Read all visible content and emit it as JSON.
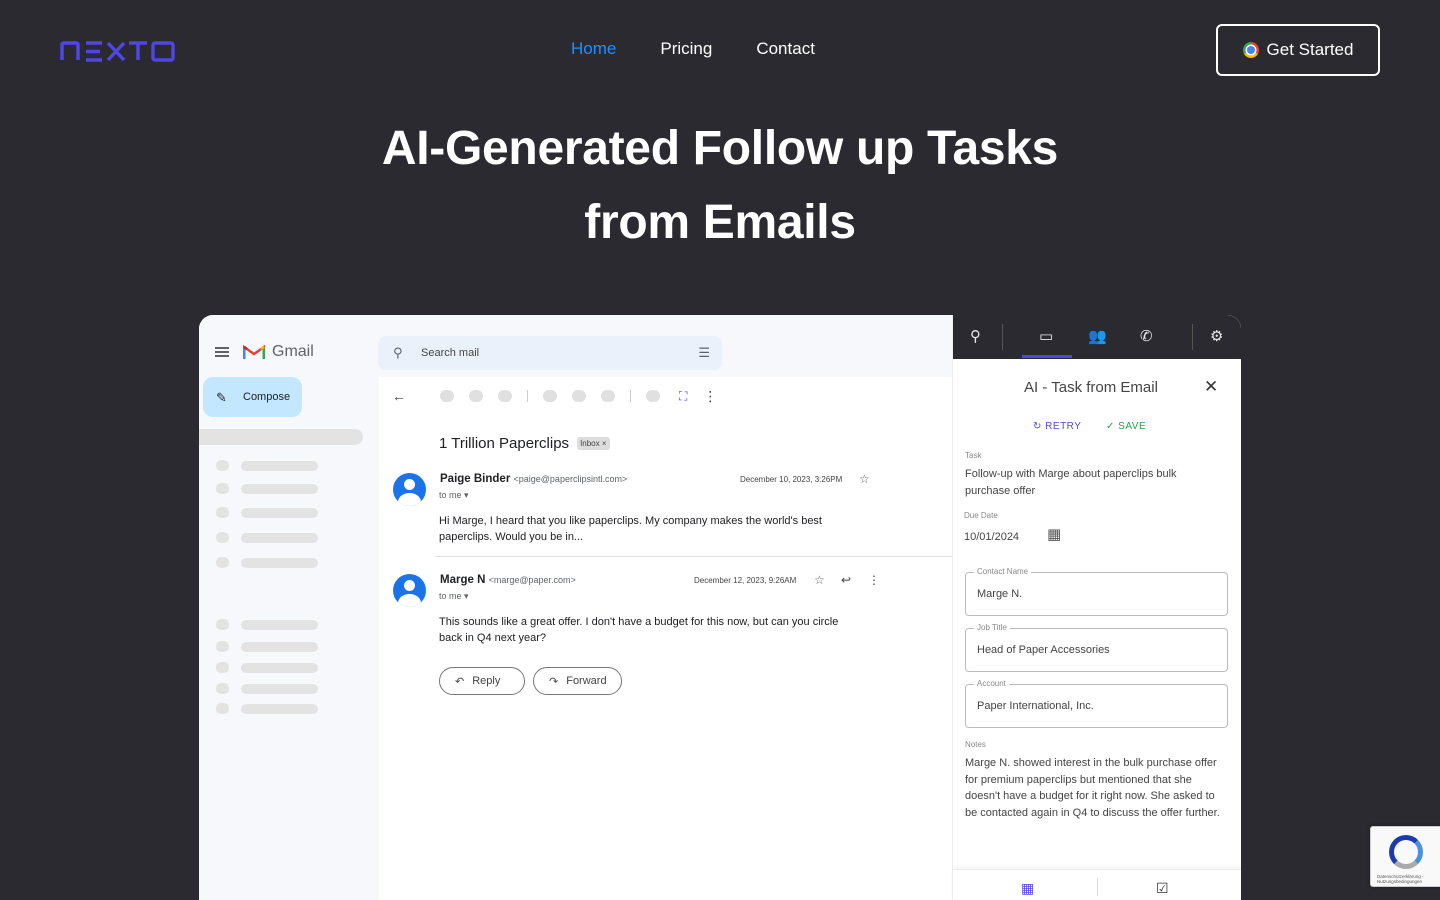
{
  "nav": {
    "logo": "nEXTO",
    "links": [
      "Home",
      "Pricing",
      "Contact"
    ],
    "cta_label": "Get Started"
  },
  "hero": {
    "line1": "AI-Generated Follow up Tasks",
    "line2": "from Emails"
  },
  "colors": {
    "accent": "#4f46e5",
    "active_link": "#1e90ff",
    "background": "#2b2a30"
  },
  "gmail": {
    "app_name": "Gmail",
    "compose_label": "Compose",
    "search_placeholder": "Search mail",
    "subject": "1 Trillion Paperclips",
    "inbox_chip": "Inbox ×",
    "messages": [
      {
        "sender": "Paige Binder",
        "email": "<paige@paperclipsintl.com>",
        "to": "to me",
        "date": "December 10, 2023, 3:26PM",
        "body": "Hi Marge, I heard that you like paperclips. My company makes the world's best paperclips. Would you be in..."
      },
      {
        "sender": "Marge N",
        "email": "<marge@paper.com>",
        "to": "to me",
        "date": "December 12, 2023, 9:26AM",
        "body": "This sounds like a great offer. I don't have a budget for this now, but can you circle back in Q4 next year?"
      }
    ],
    "reply_label": "Reply",
    "forward_label": "Forward"
  },
  "panel": {
    "title": "AI - Task from Email",
    "retry_label": "RETRY",
    "save_label": "SAVE",
    "task_label": "Task",
    "task_value": "Follow-up with Marge about paperclips bulk purchase offer",
    "due_label": "Due Date",
    "due_value": "10/01/2024",
    "contact_label": "Contact Name",
    "contact_value": "Marge N.",
    "job_label": "Job Title",
    "job_value": "Head of Paper Accessories",
    "account_label": "Account",
    "account_value": "Paper International, Inc.",
    "notes_label": "Notes",
    "notes_value": "Marge N. showed interest in the bulk purchase offer for premium paperclips but mentioned that she doesn't have a budget for it right now. She asked to be contacted again in Q4 to discuss the offer further."
  },
  "recaptcha": {
    "text": "Datenschutzerklärung - Nutzungsbedingungen"
  }
}
